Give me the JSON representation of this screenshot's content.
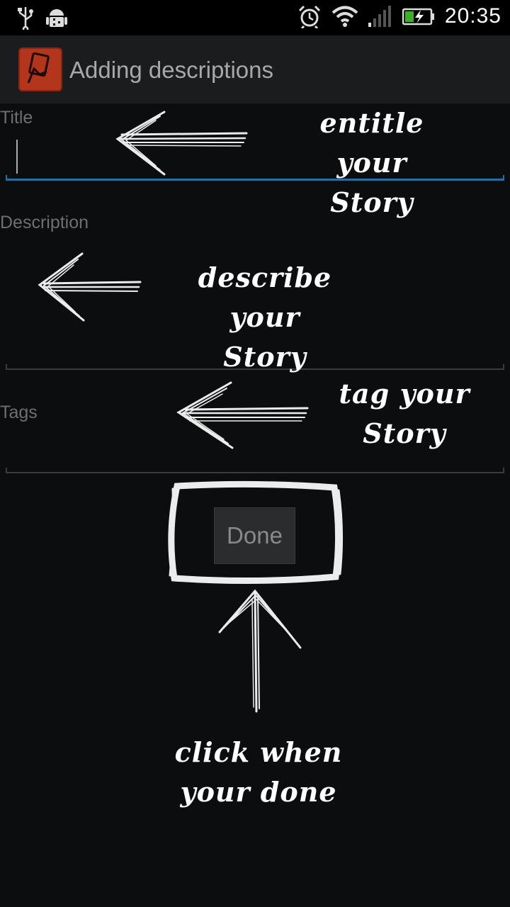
{
  "status_bar": {
    "time": "20:35",
    "icons": [
      "usb-icon",
      "android-debug-icon",
      "alarm-icon",
      "wifi-icon",
      "signal-icon",
      "battery-charging-icon"
    ]
  },
  "action_bar": {
    "app_icon": "app-logo-icon",
    "title": "Adding descriptions"
  },
  "form": {
    "title_label": "Title",
    "title_value": "",
    "description_label": "Description",
    "description_value": "",
    "tags_label": "Tags",
    "tags_value": "",
    "done_label": "Done"
  },
  "annotations": {
    "title_note_line1": "entitle your",
    "title_note_line2": "Story",
    "description_note_line1": "describe your",
    "description_note_line2": "Story",
    "tags_note_line1": "tag your",
    "tags_note_line2": "Story",
    "done_note_line1": "click when",
    "done_note_line2": "your done"
  },
  "colors": {
    "background": "#0c0d0f",
    "action_bar": "#1b1c1e",
    "focus_accent": "#2a6fa1",
    "app_icon": "#b3361c"
  }
}
